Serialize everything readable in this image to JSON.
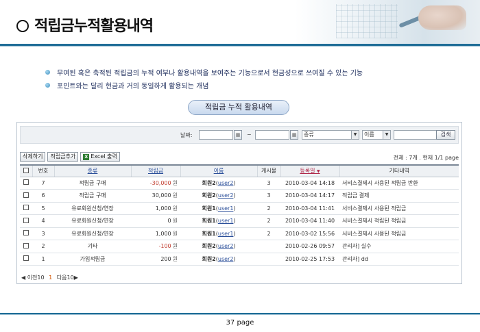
{
  "title": "적립금누적활용내역",
  "bullets": [
    "무여된 혹은 축적된 적립금의 누적 여부나 활용내역을 보여주는 기능으로서 현금성으로 쓰여질 수 있는 기능",
    "포인트와는 달리 현금과 거의 동일하게 활용되는 개념"
  ],
  "pill_label": "적립금 누적 활용내역",
  "filter": {
    "date_label": "날짜:",
    "tilde": "~",
    "type_select": "종류",
    "name_select": "이름",
    "search_button": "검색"
  },
  "toolbar": {
    "delete": "삭제하기",
    "add": "적립금추가",
    "excel": "Excel 출력",
    "excel_icon": "excel-icon"
  },
  "summary": "전체 : 7개 . 현재 1/1 page",
  "table": {
    "headers": [
      "",
      "번호",
      "종류",
      "적립금",
      "이름",
      "게시물",
      "등록일",
      "기타내역"
    ],
    "sort_marker": "▼",
    "unit": "원",
    "rows": [
      {
        "no": "7",
        "type": "적립금 구매",
        "amount": "-30,000",
        "name": "회원2",
        "uid": "user2",
        "posts": "3",
        "date": "2010-03-04 14:18",
        "note": "서비스결제시 사용된 적립금 반환"
      },
      {
        "no": "6",
        "type": "적립금 구매",
        "amount": "30,000",
        "name": "회원2",
        "uid": "user2",
        "posts": "3",
        "date": "2010-03-04 14:17",
        "note": "적립금 결제"
      },
      {
        "no": "5",
        "type": "유료회원신청/연장",
        "amount": "1,000",
        "name": "회원1",
        "uid": "user1",
        "posts": "2",
        "date": "2010-03-04 11:41",
        "note": "서비스결제시 사용된 적립금"
      },
      {
        "no": "4",
        "type": "유료회원신청/연장",
        "amount": "0",
        "name": "회원1",
        "uid": "user1",
        "posts": "2",
        "date": "2010-03-04 11:40",
        "note": "서비스결제시 적립된 적립금"
      },
      {
        "no": "3",
        "type": "유료회원신청/연장",
        "amount": "1,000",
        "name": "회원1",
        "uid": "user1",
        "posts": "2",
        "date": "2010-03-02 15:56",
        "note": "서비스결제시 사용된 적립금"
      },
      {
        "no": "2",
        "type": "기타",
        "amount": "-100",
        "name": "회원2",
        "uid": "user2",
        "posts": "",
        "date": "2010-02-26 09:57",
        "note": "관리자] 실수"
      },
      {
        "no": "1",
        "type": "가입적립금",
        "amount": "200",
        "name": "회원2",
        "uid": "user2",
        "posts": "",
        "date": "2010-02-25 17:53",
        "note": "관리자] dd"
      }
    ]
  },
  "pager": {
    "prev": "◀ 이전10",
    "current": "1",
    "next": "다음10▶"
  },
  "page_number": "37 page"
}
